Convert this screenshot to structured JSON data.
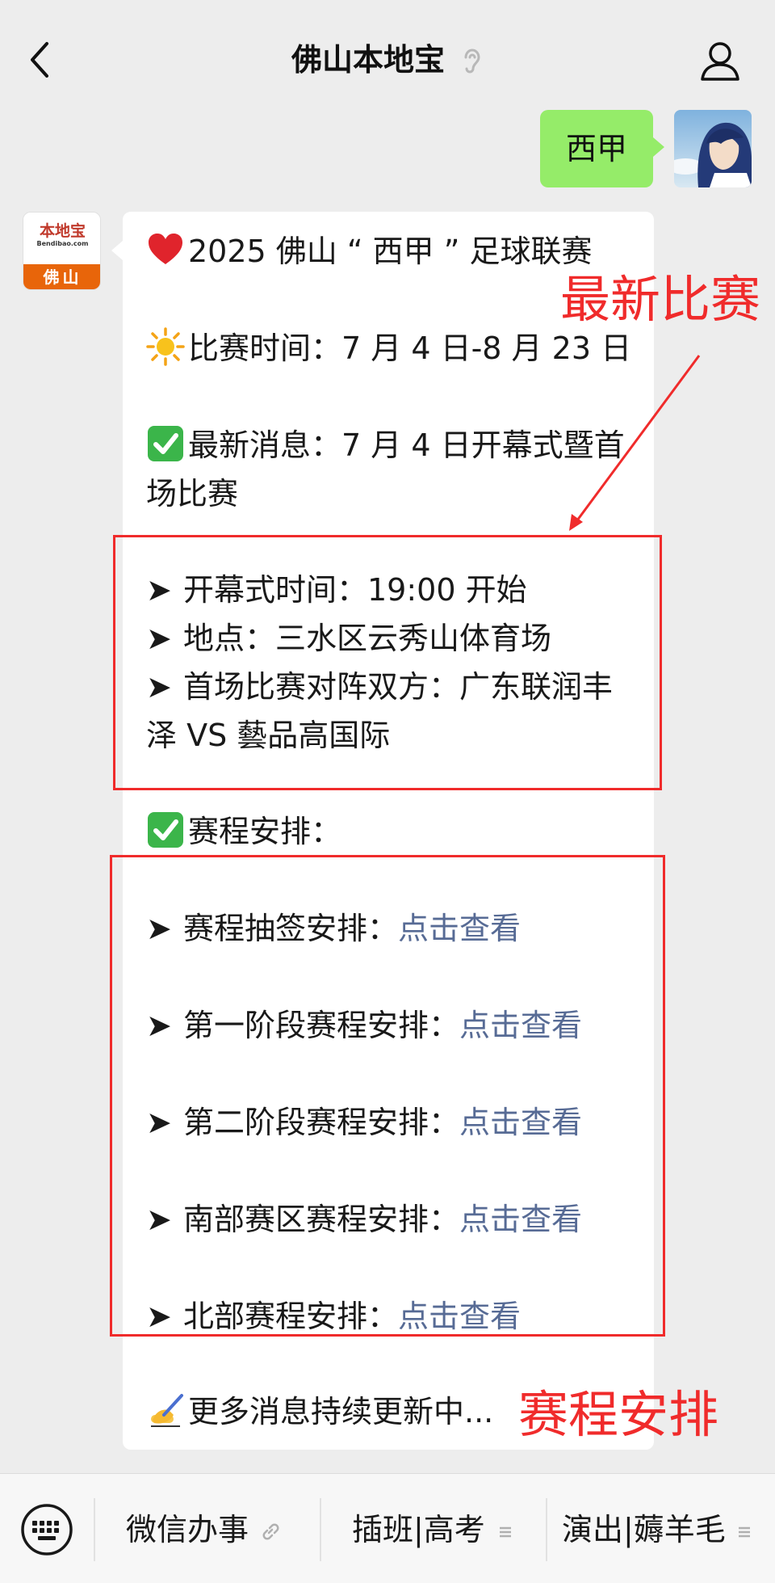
{
  "header": {
    "title": "佛山本地宝"
  },
  "chat": {
    "user_message": "西甲",
    "bot_avatar": {
      "logo_text": "本地宝",
      "logo_sub": "Bendibao.com",
      "city": "佛山"
    },
    "lines": {
      "title": "2025 佛山 “ 西甲 ” 足球联赛",
      "time": "比赛时间：7 月 4 日-8 月 23 日",
      "news_1": "最新消息：7 月 4 日开幕式暨首",
      "news_2": "场比赛",
      "opening": "开幕式时间：19:00 开始",
      "venue": "地点：三水区云秀山体育场",
      "match_1": "首场比赛对阵双方：广东联润丰",
      "match_2": "泽 VS 藝品高国际",
      "schedule_head": "赛程安排：",
      "draw_label": "赛程抽签安排：",
      "stage1_label": "第一阶段赛程安排：",
      "stage2_label": "第二阶段赛程安排：",
      "south_label": "南部赛区赛程安排：",
      "north_label": "北部赛程安排：",
      "link_text": "点击查看",
      "more": "更多消息持续更新中..."
    },
    "arrow_char": "➤"
  },
  "annotations": {
    "label_latest": "最新比赛",
    "label_schedule": "赛程安排",
    "color": "#f02b2b"
  },
  "bottom_menu": {
    "items": [
      "微信办事",
      "插班|高考",
      "演出|薅羊毛"
    ]
  },
  "colors": {
    "background": "#ededed",
    "user_bubble": "#95ec69",
    "link": "#576b95",
    "logo_orange": "#e8650a"
  }
}
